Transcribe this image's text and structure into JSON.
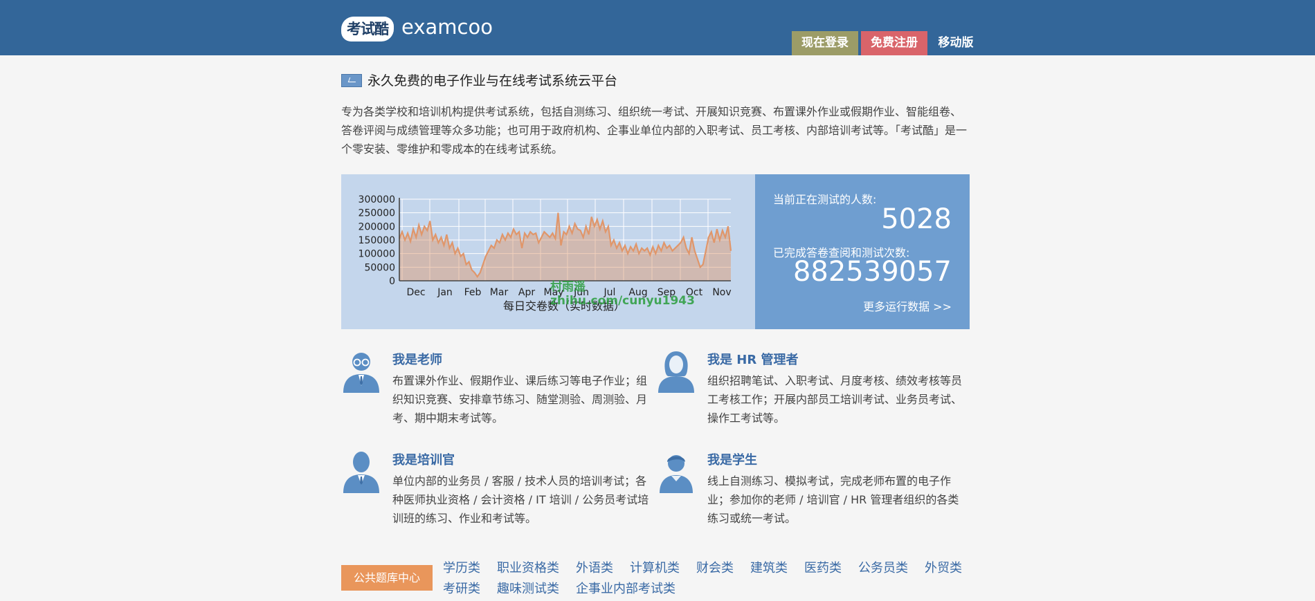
{
  "header": {
    "logo_badge": "考试酷",
    "logo_text": "examcoo",
    "login_label": "现在登录",
    "register_label": "免费注册",
    "mobile_label": "移动版",
    "colors": {
      "bar": "#336699",
      "login": "#9c9c67",
      "register": "#d9646a"
    }
  },
  "tagline": "永久免费的电子作业与在线考试系统云平台",
  "intro": "专为各类学校和培训机构提供考试系统，包括自测练习、组织统一考试、开展知识竞赛、布置课外作业或假期作业、智能组卷、答卷评阅与成绩管理等众多功能；也可用于政府机构、企事业单位内部的入职考试、员工考核、内部培训考试等。「考试酷」是一个零安装、零维护和零成本的在线考试系统。",
  "chart_data": {
    "type": "area",
    "xlabel": "每日交卷数（实时数据）",
    "ylim": [
      0,
      300000
    ],
    "yticks": [
      300000,
      250000,
      200000,
      150000,
      100000,
      50000,
      0
    ],
    "months": [
      "Dec",
      "Jan",
      "Feb",
      "Mar",
      "Apr",
      "May",
      "Jun",
      "Jul",
      "Aug",
      "Sep",
      "Oct",
      "Nov"
    ],
    "color": "#e0966a",
    "values": [
      155000,
      180000,
      150000,
      175000,
      145000,
      190000,
      160000,
      205000,
      170000,
      200000,
      185000,
      220000,
      150000,
      170000,
      140000,
      160000,
      130000,
      170000,
      120000,
      140000,
      100000,
      120000,
      90000,
      100000,
      60000,
      70000,
      40000,
      30000,
      15000,
      30000,
      60000,
      90000,
      110000,
      130000,
      120000,
      150000,
      140000,
      170000,
      150000,
      175000,
      160000,
      190000,
      170000,
      180000,
      120000,
      175000,
      160000,
      180000,
      170000,
      175000,
      140000,
      160000,
      180000,
      170000,
      160000,
      175000,
      155000,
      250000,
      130000,
      180000,
      170000,
      200000,
      175000,
      210000,
      190000,
      185000,
      160000,
      200000,
      170000,
      235000,
      200000,
      225000,
      190000,
      220000,
      180000,
      200000,
      130000,
      150000,
      120000,
      140000,
      110000,
      130000,
      100000,
      125000,
      110000,
      135000,
      100000,
      120000,
      110000,
      120000,
      95000,
      125000,
      100000,
      130000,
      110000,
      140000,
      120000,
      130000,
      110000,
      120000,
      130000,
      140000,
      160000,
      120000,
      100000,
      160000,
      110000,
      80000,
      50000,
      60000,
      110000,
      160000,
      180000,
      140000,
      190000,
      150000,
      185000,
      160000,
      200000,
      110000
    ]
  },
  "stats": {
    "testing_label": "当前正在测试的人数:",
    "testing_value": "5028",
    "completed_label": "已完成答卷查阅和测试次数:",
    "completed_value": "882539057",
    "more_link": "更多运行数据 >>"
  },
  "roles": [
    {
      "title": "我是老师",
      "desc": "布置课外作业、假期作业、课后练习等电子作业；组织知识竞赛、安排章节练习、随堂测验、周测验、月考、期中期末考试等。",
      "icon": "teacher-avatar-icon"
    },
    {
      "title": "我是 HR 管理者",
      "desc": "组织招聘笔试、入职考试、月度考核、绩效考核等员工考核工作；开展内部员工培训考试、业务员考试、操作工考试等。",
      "icon": "hr-manager-avatar-icon"
    },
    {
      "title": "我是培训官",
      "desc": "单位内部的业务员 / 客服 / 技术人员的培训考试；各种医师执业资格 / 会计资格 / IT 培训 / 公务员考试培训班的练习、作业和考试等。",
      "icon": "trainer-avatar-icon"
    },
    {
      "title": "我是学生",
      "desc": "线上自测练习、模拟考试，完成老师布置的电子作业；参加你的老师 / 培训官 / HR 管理者组织的各类练习或统一考试。",
      "icon": "student-avatar-icon"
    }
  ],
  "question_bank": {
    "badge": "公共题库中心",
    "categories": [
      "学历类",
      "职业资格类",
      "外语类",
      "计算机类",
      "财会类",
      "建筑类",
      "医药类",
      "公务员类",
      "外贸类",
      "考研类",
      "趣味测试类",
      "企事业内部考试类"
    ]
  },
  "watermark": {
    "line1": "村雨遥",
    "line2": "zhihu.com/cunyu1943"
  }
}
